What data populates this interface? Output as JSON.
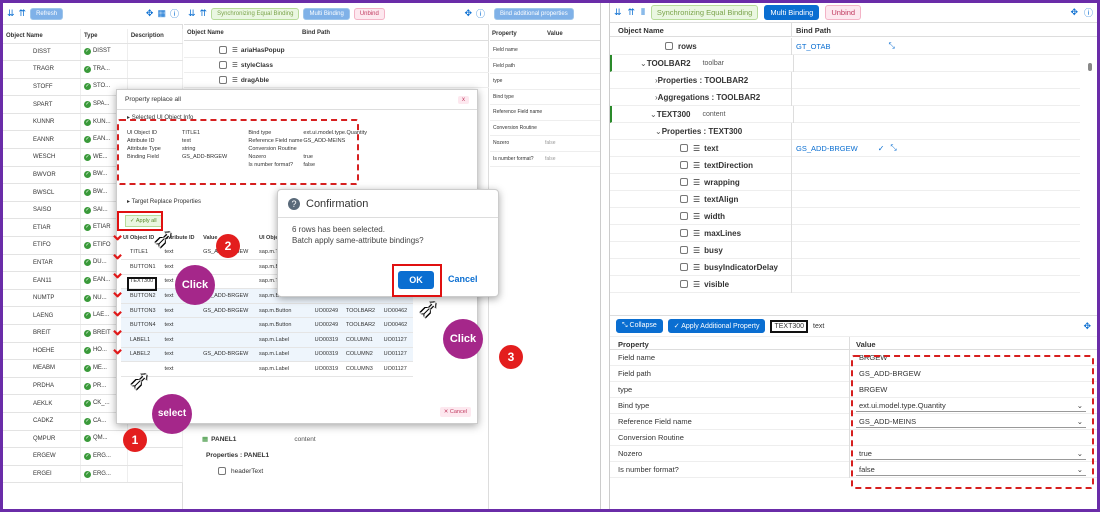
{
  "left_toolbar": {
    "refresh": "Refresh"
  },
  "left_cols": {
    "name": "Object Name",
    "type": "Type",
    "desc": "Description"
  },
  "left_rows": [
    {
      "n": "DISST",
      "t": "DISST"
    },
    {
      "n": "TRAGR",
      "t": "TRA..."
    },
    {
      "n": "STOFF",
      "t": "STO..."
    },
    {
      "n": "SPART",
      "t": "SPA..."
    },
    {
      "n": "KUNNR",
      "t": "KUN..."
    },
    {
      "n": "EANNR",
      "t": "EAN..."
    },
    {
      "n": "WESCH",
      "t": "WE..."
    },
    {
      "n": "BWVOR",
      "t": "BW..."
    },
    {
      "n": "BWSCL",
      "t": "BW..."
    },
    {
      "n": "SAISO",
      "t": "SAI..."
    },
    {
      "n": "ETIAR",
      "t": "ETIAR"
    },
    {
      "n": "ETIFO",
      "t": "ETIFO"
    },
    {
      "n": "ENTAR",
      "t": "DU..."
    },
    {
      "n": "EAN11",
      "t": "EAN..."
    },
    {
      "n": "NUMTP",
      "t": "NU..."
    },
    {
      "n": "LAENG",
      "t": "LAE..."
    },
    {
      "n": "BREIT",
      "t": "BREIT"
    },
    {
      "n": "HOEHE",
      "t": "HO..."
    },
    {
      "n": "MEABM",
      "t": "ME..."
    },
    {
      "n": "PRDHA",
      "t": "PR..."
    },
    {
      "n": "AEKLK",
      "t": "CK_..."
    },
    {
      "n": "CADKZ",
      "t": "CA..."
    },
    {
      "n": "QMPUR",
      "t": "QM..."
    },
    {
      "n": "ERGEW",
      "t": "ERG..."
    },
    {
      "n": "ERGEI",
      "t": "ERG..."
    }
  ],
  "mid_toolbar": {
    "sync": "Synchronizing Equal Binding",
    "multi": "Multi Binding",
    "unbind": "Unbind"
  },
  "mid_cols": {
    "name": "Object Name",
    "bind": "Bind Path"
  },
  "mid_rows": [
    "ariaHasPopup",
    "styleClass",
    "dragAble"
  ],
  "mid_bottom": {
    "panel": "PANEL1",
    "content": "content",
    "props": "Properties : PANEL1",
    "header": "headerText"
  },
  "addl": {
    "btn": "Bind additional properties",
    "col_prop": "Property",
    "col_val": "Value",
    "rows": [
      "Field name",
      "Field path",
      "type",
      "Bind type",
      "Reference Field name",
      "Conversion Routine",
      "Nozero",
      "Is number format?"
    ],
    "nozero": "false",
    "isnum": "false"
  },
  "prop_dialog": {
    "title": "Property replace all",
    "close": "x",
    "section1": "Selected UI Object Info",
    "info_left": [
      [
        "UI Object ID",
        "TITLE1"
      ],
      [
        "Attribute ID",
        "text"
      ],
      [
        "Attribute Type",
        "string"
      ],
      [
        "Binding Field",
        "GS_ADD-BRGEW"
      ]
    ],
    "info_right": [
      [
        "Bind type",
        "ext.ui.model.type.Quantity"
      ],
      [
        "Reference Field name",
        "GS_ADD-MEINS"
      ],
      [
        "Conversion Routine",
        ""
      ],
      [
        "Nozero",
        "true"
      ],
      [
        "Is number format?",
        "false"
      ]
    ],
    "section2": "Target Replace Properties",
    "apply_all": "Apply all",
    "cols": [
      "UI Object ID",
      "Attribute ID",
      "Value",
      "UI Object Module",
      "",
      "",
      ""
    ],
    "rows": [
      [
        "TITLE1",
        "text",
        "GS_ADD-BRGEW",
        "sap.m.Title",
        "",
        "",
        ""
      ],
      [
        "BUTTON1",
        "text",
        "",
        "sap.m.Button",
        "",
        "",
        ""
      ],
      [
        "TEXT300",
        "text",
        "",
        "sap.m.Text",
        "",
        "",
        ""
      ],
      [
        "BUTTON2",
        "text",
        "GS_ADD-BRGEW",
        "sap.m.Button",
        "UO00249",
        "TOOLBAR2",
        "UO00462"
      ],
      [
        "BUTTON3",
        "text",
        "GS_ADD-BRGEW",
        "sap.m.Button",
        "UO00249",
        "TOOLBAR2",
        "UO00462"
      ],
      [
        "BUTTON4",
        "text",
        "",
        "sap.m.Button",
        "UO00249",
        "TOOLBAR2",
        "UO00462"
      ],
      [
        "LABEL1",
        "text",
        "",
        "sap.m.Label",
        "UO00319",
        "COLUMN1",
        "UO01127"
      ],
      [
        "LABEL2",
        "text",
        "GS_ADD-BRGEW",
        "sap.m.Label",
        "UO00319",
        "COLUMN2",
        "UO01127"
      ],
      [
        "",
        "text",
        "",
        "sap.m.Label",
        "UO00319",
        "COLUMN3",
        "UO01127"
      ]
    ],
    "cancel": "Cancel"
  },
  "confirm": {
    "title": "Confirmation",
    "line1": "6 rows has been selected.",
    "line2": "Batch apply same-attribute bindings?",
    "ok": "OK",
    "cancel": "Cancel"
  },
  "annot": {
    "n1": "1",
    "n2": "2",
    "n3": "3",
    "click": "Click",
    "select": "select"
  },
  "right_toolbar": {
    "sync": "Synchronizing Equal Binding",
    "multi": "Multi Binding",
    "unbind": "Unbind"
  },
  "right_cols": {
    "name": "Object Name",
    "bind": "Bind Path"
  },
  "tree": [
    {
      "label": "rows",
      "bind": "GT_OTAB"
    },
    {
      "label": "TOOLBAR2",
      "tag": "toolbar"
    },
    {
      "label": "Properties : TOOLBAR2"
    },
    {
      "label": "Aggregations : TOOLBAR2"
    },
    {
      "label": "TEXT300",
      "tag": "content"
    },
    {
      "label": "Properties : TEXT300"
    },
    {
      "label": "text",
      "bind": "GS_ADD-BRGEW"
    },
    {
      "label": "textDirection"
    },
    {
      "label": "wrapping"
    },
    {
      "label": "textAlign"
    },
    {
      "label": "width"
    },
    {
      "label": "maxLines"
    },
    {
      "label": "busy"
    },
    {
      "label": "busyIndicatorDelay"
    },
    {
      "label": "visible"
    }
  ],
  "bottom": {
    "collapse": "Collapse",
    "apply": "Apply Additional Property",
    "obj": "TEXT300",
    "attr": "text",
    "col_prop": "Property",
    "col_val": "Value",
    "rows": [
      {
        "p": "Field name",
        "v": "BRGEW"
      },
      {
        "p": "Field path",
        "v": "GS_ADD-BRGEW"
      },
      {
        "p": "type",
        "v": "BRGEW"
      },
      {
        "p": "Bind type",
        "v": "ext.ui.model.type.Quantity",
        "sel": true
      },
      {
        "p": "Reference Field name",
        "v": "GS_ADD-MEINS",
        "sel": true
      },
      {
        "p": "Conversion Routine",
        "v": ""
      },
      {
        "p": "Nozero",
        "v": "true",
        "sel": true
      },
      {
        "p": "Is number format?",
        "v": "false",
        "sel": true
      }
    ]
  }
}
